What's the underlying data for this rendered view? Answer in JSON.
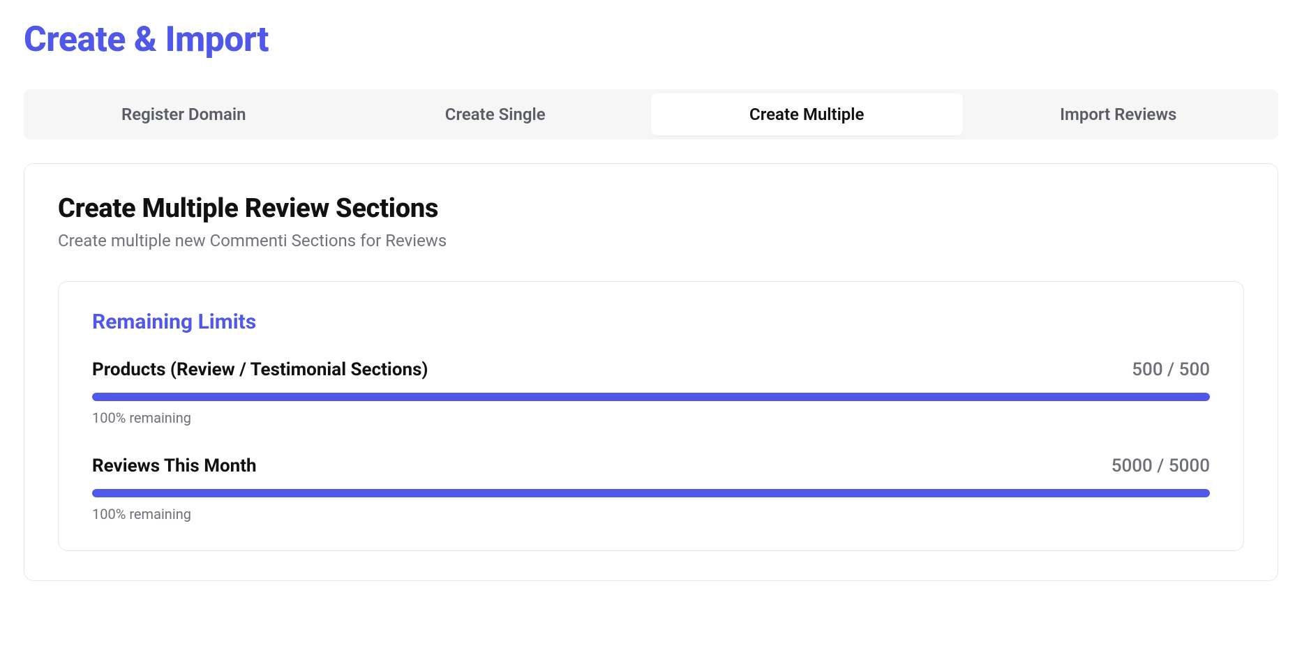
{
  "pageTitle": "Create & Import",
  "tabs": [
    {
      "label": "Register Domain",
      "active": false
    },
    {
      "label": "Create Single",
      "active": false
    },
    {
      "label": "Create Multiple",
      "active": true
    },
    {
      "label": "Import Reviews",
      "active": false
    }
  ],
  "card": {
    "title": "Create Multiple Review Sections",
    "subtitle": "Create multiple new Commenti Sections for Reviews"
  },
  "limits": {
    "title": "Remaining Limits",
    "items": [
      {
        "label": "Products (Review / Testimonial Sections)",
        "value": "500 / 500",
        "percent": 100,
        "caption": "100% remaining"
      },
      {
        "label": "Reviews This Month",
        "value": "5000 / 5000",
        "percent": 100,
        "caption": "100% remaining"
      }
    ]
  },
  "colors": {
    "accent": "#4f58e8"
  }
}
